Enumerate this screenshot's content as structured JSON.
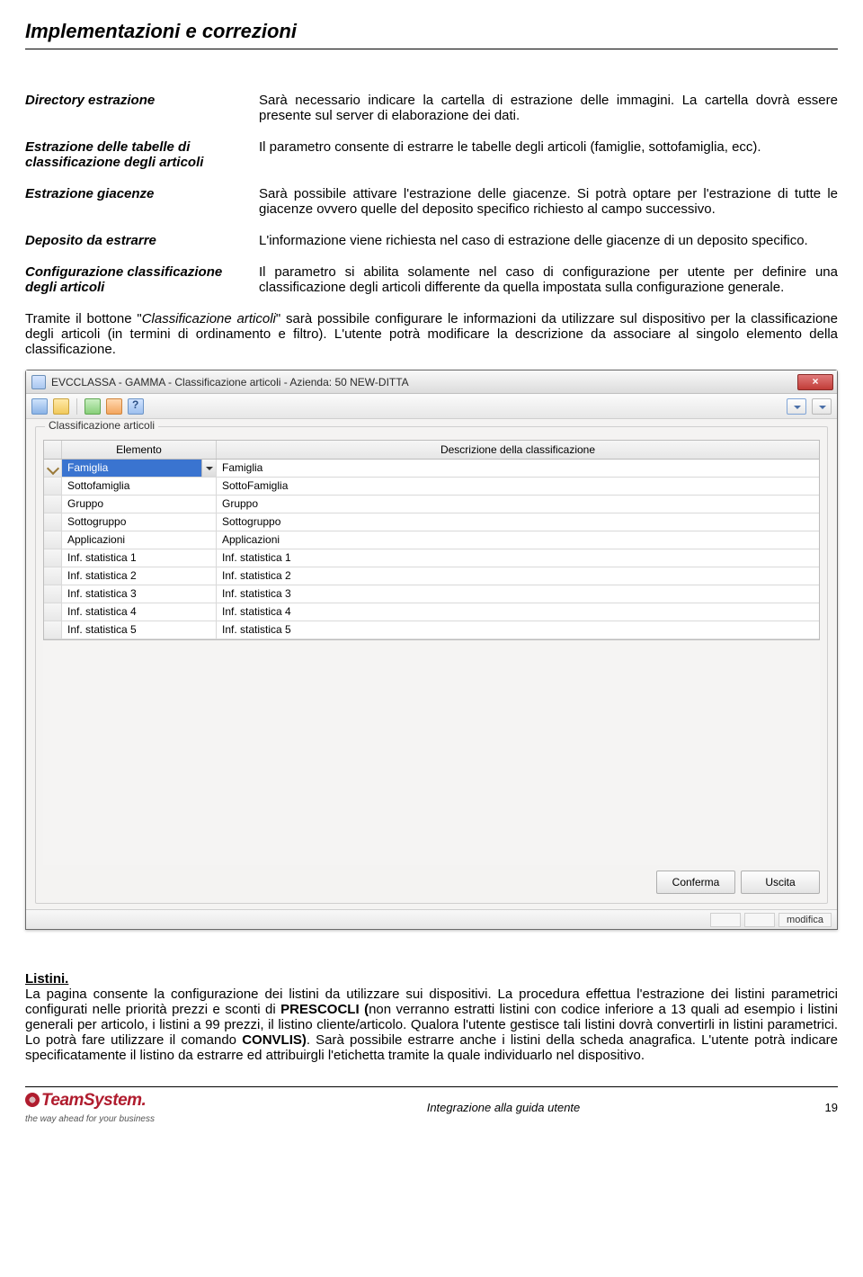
{
  "header": "Implementazioni e correzioni",
  "definitions": [
    {
      "term": "Directory estrazione",
      "desc": "Sarà necessario indicare la cartella di estrazione delle immagini. La cartella dovrà essere presente sul server di elaborazione dei dati."
    },
    {
      "term": "Estrazione delle tabelle di classificazione degli articoli",
      "desc": "Il parametro consente di estrarre le tabelle degli articoli (famiglie, sottofamiglia, ecc)."
    },
    {
      "term": "Estrazione giacenze",
      "desc": "Sarà possibile attivare l'estrazione delle giacenze. Si potrà optare per l'estrazione di tutte le giacenze ovvero quelle del deposito specifico richiesto al campo successivo."
    },
    {
      "term": "Deposito da estrarre",
      "desc": "L'informazione viene richiesta nel caso di estrazione delle giacenze di un deposito specifico."
    },
    {
      "term": "Configurazione classificazione degli articoli",
      "desc": "Il parametro si abilita solamente nel caso di configurazione per utente per definire una classificazione degli articoli differente da quella impostata sulla configurazione generale."
    }
  ],
  "body_para_parts": {
    "p1a": "Tramite il bottone \"",
    "p1b": "Classificazione articoli",
    "p1c": "\" sarà possibile configurare le informazioni da utilizzare sul dispositivo per la classificazione degli articoli (in termini di ordinamento e filtro). L'utente potrà modificare la descrizione da associare al singolo elemento della classificazione."
  },
  "window": {
    "title": "EVCCLASSA - GAMMA - Classificazione articoli - Azienda:   50 NEW-DITTA",
    "close": "×",
    "group_legend": "Classificazione articoli",
    "col1": "Elemento",
    "col2": "Descrizione della classificazione",
    "rows": [
      {
        "elemento": "Famiglia",
        "descrizione": "Famiglia",
        "selected": true
      },
      {
        "elemento": "Sottofamiglia",
        "descrizione": "SottoFamiglia"
      },
      {
        "elemento": "Gruppo",
        "descrizione": "Gruppo"
      },
      {
        "elemento": "Sottogruppo",
        "descrizione": "Sottogruppo"
      },
      {
        "elemento": "Applicazioni",
        "descrizione": "Applicazioni"
      },
      {
        "elemento": "Inf. statistica 1",
        "descrizione": "Inf. statistica 1"
      },
      {
        "elemento": "Inf. statistica 2",
        "descrizione": "Inf. statistica 2"
      },
      {
        "elemento": "Inf. statistica 3",
        "descrizione": "Inf. statistica 3"
      },
      {
        "elemento": "Inf. statistica 4",
        "descrizione": "Inf. statistica 4"
      },
      {
        "elemento": "Inf. statistica 5",
        "descrizione": "Inf. statistica 5"
      }
    ],
    "buttons": {
      "confirm": "Conferma",
      "exit": "Uscita"
    },
    "status": "modifica"
  },
  "listini": {
    "heading": "Listini.",
    "a": "La pagina consente la configurazione dei listini da utilizzare sui dispositivi. La procedura effettua l'estrazione dei listini parametrici configurati nelle priorità prezzi e sconti di ",
    "b": "PRESCOCLI (",
    "c": "non verranno estratti listini con codice inferiore a 13 quali ad esempio i listini generali per articolo, i listini a 99 prezzi, il listino cliente/articolo. Qualora l'utente gestisce tali listini dovrà convertirli in listini parametrici. Lo potrà fare utilizzare il comando ",
    "d": "CONVLIS)",
    "e": ". Sarà possibile estrarre anche i listini della scheda anagrafica. L'utente potrà indicare specificatamente il listino da estrarre ed attribuirgli l'etichetta tramite la quale individuarlo nel dispositivo."
  },
  "footer": {
    "brand": "TeamSystem",
    "tagline": "the way ahead for your business",
    "center": "Integrazione alla guida utente",
    "page": "19"
  }
}
